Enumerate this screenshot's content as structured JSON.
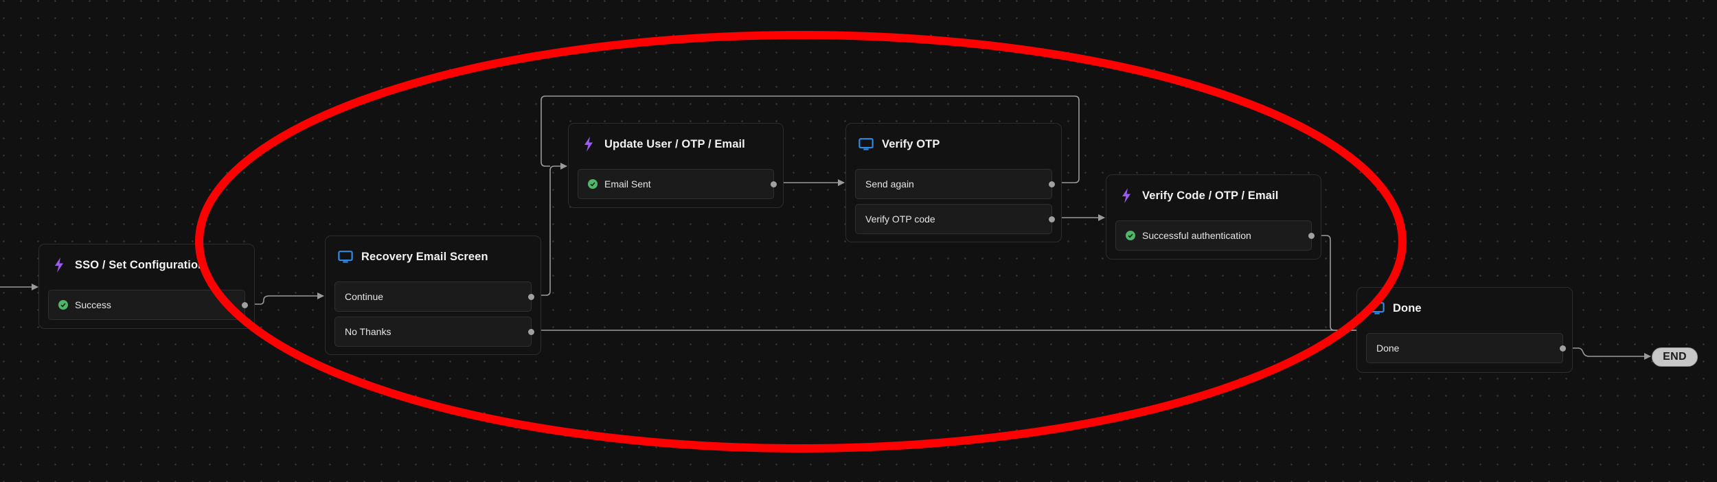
{
  "canvas": {
    "background": "#111112",
    "edge_color": "#9a9a9a",
    "accent_action": "#9b5cf0",
    "accent_screen": "#2f8ae6",
    "accent_success": "#4fb66a",
    "highlight_color": "#ff0000"
  },
  "nodes": {
    "sso": {
      "type": "action",
      "icon": "lightning-bolt-icon",
      "title": "SSO / Set Configuration",
      "outputs": [
        {
          "label": "Success",
          "status_icon": "check-circle-icon"
        }
      ]
    },
    "recovery_email": {
      "type": "screen",
      "icon": "monitor-icon",
      "title": "Recovery Email Screen",
      "outputs": [
        {
          "label": "Continue"
        },
        {
          "label": "No Thanks"
        }
      ]
    },
    "update_user": {
      "type": "action",
      "icon": "lightning-bolt-icon",
      "title": "Update User / OTP / Email",
      "outputs": [
        {
          "label": "Email Sent",
          "status_icon": "check-circle-icon"
        }
      ]
    },
    "verify_otp": {
      "type": "screen",
      "icon": "monitor-icon",
      "title": "Verify OTP",
      "outputs": [
        {
          "label": "Send again"
        },
        {
          "label": "Verify OTP code"
        }
      ]
    },
    "verify_code": {
      "type": "action",
      "icon": "lightning-bolt-icon",
      "title": "Verify Code / OTP / Email",
      "outputs": [
        {
          "label": "Successful authentication",
          "status_icon": "check-circle-icon"
        }
      ]
    },
    "done": {
      "type": "screen",
      "icon": "monitor-icon",
      "title": "Done",
      "outputs": [
        {
          "label": "Done"
        }
      ]
    }
  },
  "end_node": {
    "label": "END"
  },
  "connections": [
    {
      "from": "start",
      "to": "sso"
    },
    {
      "from": "sso.Success",
      "to": "recovery_email"
    },
    {
      "from": "recovery_email.Continue",
      "to": "update_user"
    },
    {
      "from": "recovery_email.No Thanks",
      "to": "done"
    },
    {
      "from": "update_user.Email Sent",
      "to": "verify_otp"
    },
    {
      "from": "verify_otp.Send again",
      "to": "update_user"
    },
    {
      "from": "verify_otp.Verify OTP code",
      "to": "verify_code"
    },
    {
      "from": "verify_code.Successful authentication",
      "to": "done"
    },
    {
      "from": "done.Done",
      "to": "end"
    }
  ],
  "annotation": {
    "shape": "ellipse",
    "description": "red ellipse highlighting recovery email / OTP section"
  }
}
